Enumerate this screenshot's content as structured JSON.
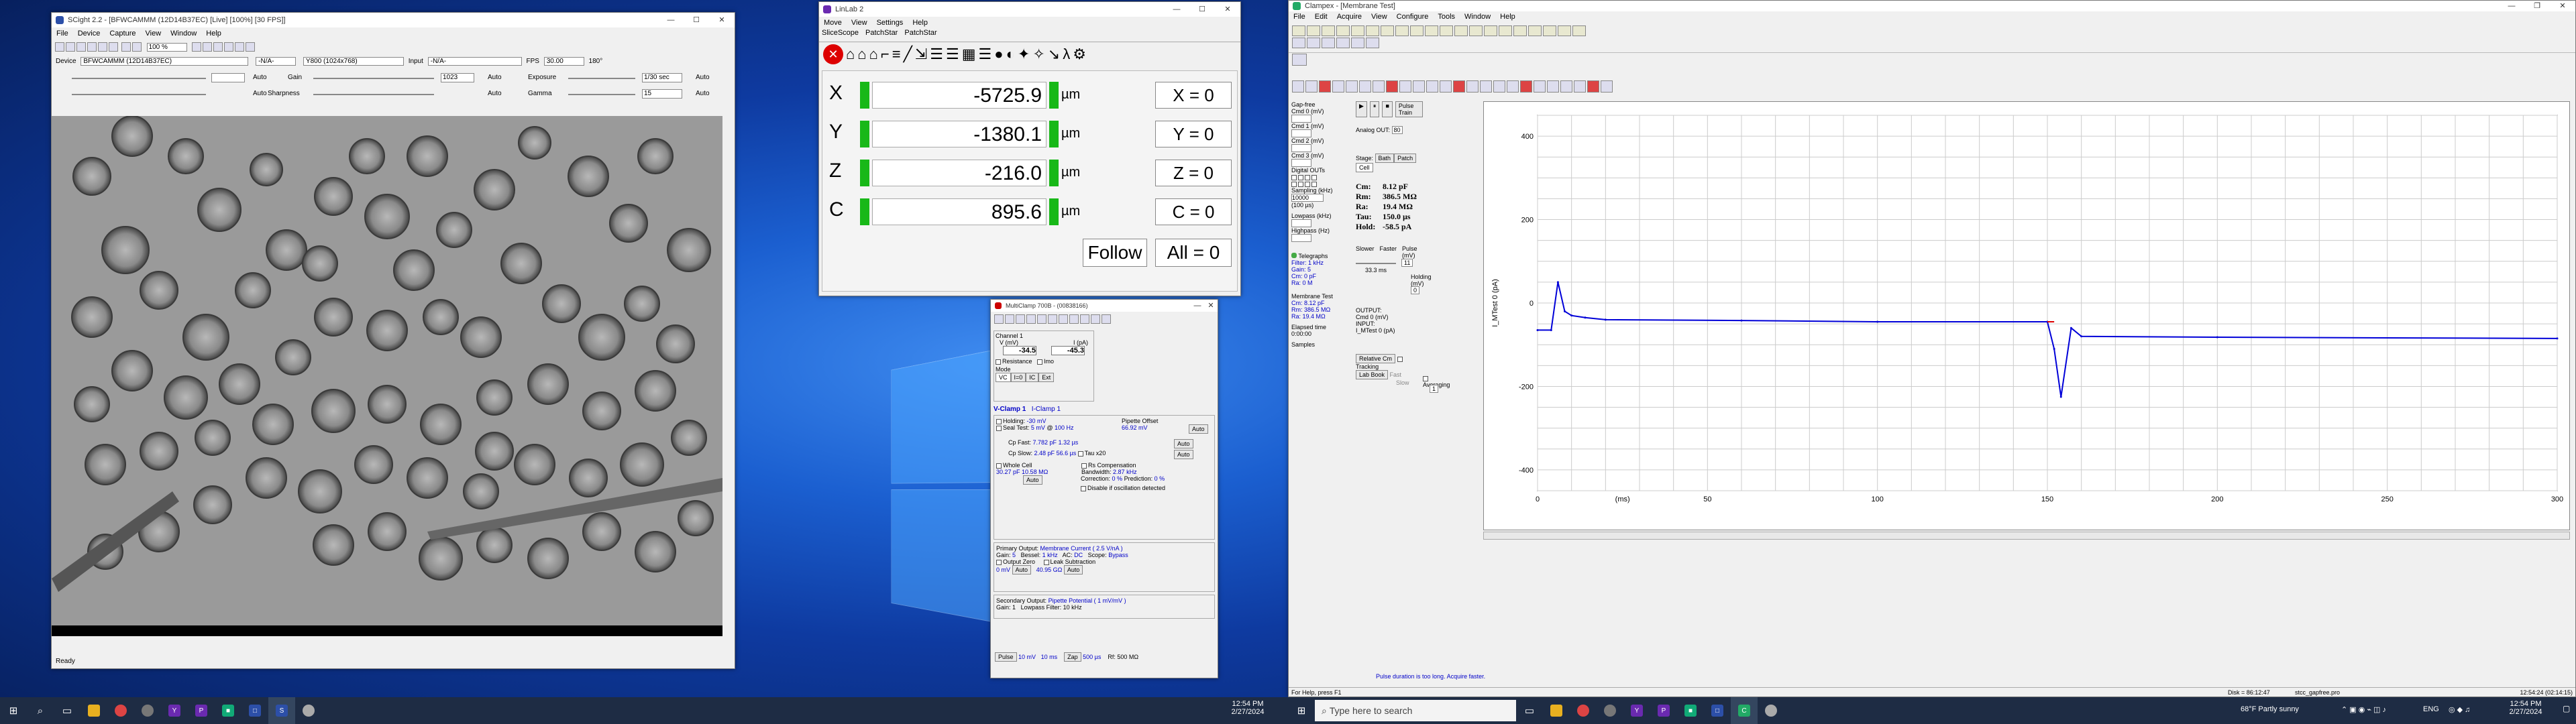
{
  "scight": {
    "title": "SCight 2.2 - [BFWCAMMM (12D14B37EC) [Live] [100%] [30 FPS]]",
    "menu": [
      "File",
      "Device",
      "Capture",
      "View",
      "Window",
      "Help"
    ],
    "zoom": "100 %",
    "device_label": "Device",
    "device_value": "BFWCAMMM (12D14B37EC)",
    "res": "Y800 (1024x768)",
    "input_label": "Input",
    "input_value": "-N/A-",
    "fps_label": "FPS",
    "fps_value": "30.00",
    "rotate": "180°",
    "gain_label": "Gain",
    "gain_value": "1023",
    "exposure_label": "Exposure",
    "exposure_value": "1/30 sec",
    "sharpness_label": "Sharpness",
    "gamma_label": "Gamma",
    "gamma_value": "15",
    "auto": "Auto",
    "status": "Ready"
  },
  "linlab": {
    "title": "LinLab 2",
    "menu": [
      "Move",
      "View",
      "Settings",
      "Help"
    ],
    "tabs": [
      "SliceScope",
      "PatchStar",
      "PatchStar"
    ],
    "unit": "µm",
    "follow": "Follow",
    "rows": [
      {
        "axis": "X",
        "value": "-5725.9",
        "zero": "X = 0"
      },
      {
        "axis": "Y",
        "value": "-1380.1",
        "zero": "Y = 0"
      },
      {
        "axis": "Z",
        "value": "-216.0",
        "zero": "Z = 0"
      },
      {
        "axis": "C",
        "value": "895.6",
        "zero": "C = 0"
      }
    ],
    "allzero": "All = 0"
  },
  "mc": {
    "title": "MultiClamp 700B - (00838166)",
    "channel": "Channel 1",
    "vlabel": "V (mV)",
    "ilabel": "I (pA)",
    "vval": "-34.5",
    "ival": "-45.3",
    "resistance": "Resistance",
    "imo": "Imo",
    "mode": "Mode",
    "modes": [
      "VC",
      "I=0",
      "IC",
      "Ext"
    ],
    "tab1": "V-Clamp 1",
    "tab2": "I-Clamp 1",
    "holding": "Holding:",
    "holding_v": "-30 mV",
    "seal": "Seal Test:",
    "seal_v": "5 mV",
    "seal_hz": "100 Hz",
    "pipette_offset": "Pipette Offset",
    "pipette_v": "66.92 mV",
    "cpfast": "Cp Fast:",
    "cpfast_v": "7.782 pF",
    "cpfast_t": "1.32 µs",
    "cpslow": "Cp Slow:",
    "cpslow_v": "2.48 pF",
    "cpslow_t": "56.6 µs",
    "tau": "Tau x20",
    "whole": "Whole Cell",
    "whole_v": "30.27 pF",
    "whole_r": "10.58 MΩ",
    "rs": "Rs Compensation",
    "bw": "Bandwidth:",
    "bw_v": "2.87 kHz",
    "corr": "Correction:",
    "corr_v": "0 %",
    "pred": "Prediction:",
    "pred_v": "0 %",
    "disable": "Disable if oscillation detected",
    "prim": "Primary Output:",
    "prim_v": "Membrane Current ( 2.5 V/nA )",
    "gain": "Gain:",
    "gain_v": "5",
    "bessel": "Bessel:",
    "bessel_v": "1 kHz",
    "ac": "AC:",
    "ac_v": "DC",
    "scope": "Scope:",
    "scope_v": "Bypass",
    "outzero": "Output Zero",
    "leak": "Leak Subtraction",
    "oz_v": "0 mV",
    "leak_v": "40.95 GΩ",
    "sec": "Secondary Output:",
    "sec_v": "Pipette Potential ( 1 mV/mV )",
    "sec_gain": "Gain:",
    "sec_gain_v": "1",
    "lp": "Lowpass Filter:",
    "lp_v": "10 kHz",
    "pulse": "Pulse",
    "pulse_v": "10 mV",
    "pulse_t": "10 ms",
    "zap": "Zap",
    "zap_t": "500 µs",
    "rf": "Rf: 500 MΩ",
    "auto": "Auto"
  },
  "cl": {
    "title": "Clampex - [Membrane Test]",
    "menu": [
      "File",
      "Edit",
      "Acquire",
      "View",
      "Configure",
      "Tools",
      "Window",
      "Help"
    ],
    "gapfree": "Gap-free",
    "cmd0": "Cmd 0 (mV)",
    "cmd1": "Cmd 1 (mV)",
    "cmd2": "Cmd 2 (mV)",
    "cmd3": "Cmd 3 (mV)",
    "digital": "Digital OUTs",
    "sampling": "Sampling (kHz)",
    "sampling_v": "10000",
    "interval": "(100 µs)",
    "lowpass": "Lowpass (kHz)",
    "highpass": "Highpass (Hz)",
    "slower": "Slower",
    "faster": "Faster",
    "pulse_mv": "Pulse (mV)",
    "pulse_v": "11",
    "hold_mv": "Holding (mV)",
    "hold_v": "0",
    "time_ms": "33.3 ms",
    "analog": "Analog OUT:",
    "analog_v": "80",
    "stage": "Stage:",
    "stages": [
      "Bath",
      "Patch",
      "Cell"
    ],
    "cm": "Cm:",
    "cm_v": "8.12 pF",
    "rm": "Rm:",
    "rm_v": "386.5 MΩ",
    "ra": "Ra:",
    "ra_v": "19.4 MΩ",
    "tau": "Tau:",
    "tau_v": "150.0 µs",
    "hold": "Hold:",
    "hold_pa": "-58.5 pA",
    "output": "OUTPUT:",
    "output_v": "Cmd 0 (mV)",
    "input": "INPUT:",
    "input_v": "I_MTest 0 (pA)",
    "averaging": "Averaging",
    "avg_v": "1",
    "telegraphs": "Telegraphs",
    "tel": [
      "Filter: 1 kHz",
      "Gain: 5",
      "Cm: 0 pF",
      "Ra: 0 M"
    ],
    "relcm": "Relative Cm",
    "labbook": "Lab Book",
    "tracking": "Tracking",
    "fast": "Fast",
    "slow": "Slow",
    "mtest": "Membrane Test",
    "mt": [
      "Cm: 8.12 pF",
      "Rm: 386.5 MΩ",
      "Ra: 19.4 MΩ"
    ],
    "elapsed": "Elapsed time",
    "elapsed_v": "0:00:00",
    "samples": "Samples",
    "warn": "Pulse duration is too long. Acquire faster.",
    "help": "For Help, press F1",
    "disk": "Disk = 86:12:47",
    "file": "stcc_gapfree.pro",
    "clock": "12:54:24 (02:14:15)",
    "ylabel": "I_MTest 0 (pA)",
    "xunit": "(ms)",
    "yticks": [
      "400",
      "200",
      "0",
      "-200",
      "-400"
    ],
    "xticks": [
      "0",
      "50",
      "100",
      "150",
      "200",
      "250",
      "300"
    ],
    "pulse_train": "Pulse Train"
  },
  "chart_data": {
    "type": "line",
    "x": [
      0,
      4,
      6,
      8,
      10,
      14,
      20,
      60,
      100,
      150,
      152,
      154,
      157,
      160,
      200,
      300
    ],
    "series": [
      {
        "values": [
          -65,
          -65,
          50,
          -20,
          -30,
          -35,
          -40,
          -42,
          -45,
          -45,
          -110,
          -225,
          -60,
          -80,
          -82,
          -85
        ],
        "color": "#0000d8"
      }
    ],
    "ylabel": "I_MTest 0 (pA)",
    "xlabel": "(ms)",
    "xlim": [
      0,
      300
    ],
    "ylim": [
      -450,
      450
    ]
  },
  "task": {
    "search": "Type here to search",
    "time": "12:54 PM",
    "date": "2/27/2024",
    "weather": "68°F  Partly sunny",
    "lang": "ENG",
    "time2": "12:54 PM",
    "date2": "2/27/2024"
  }
}
